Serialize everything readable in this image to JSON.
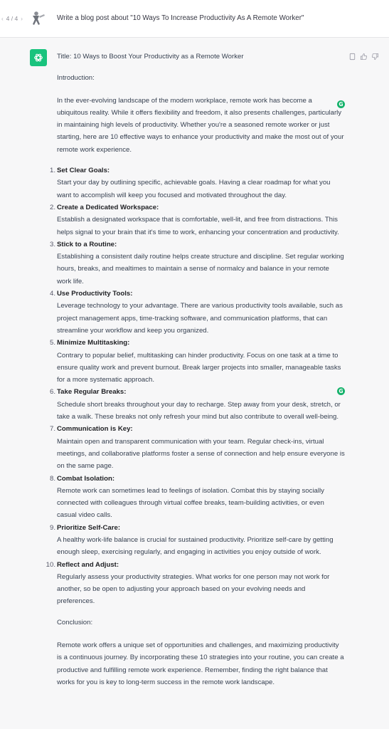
{
  "user": {
    "pager": "4 / 4",
    "prompt": "Write a blog post about \"10 Ways To Increase Productivity As A Remote Worker\""
  },
  "assistant": {
    "title": "Title: 10 Ways to Boost Your Productivity as a Remote Worker",
    "intro_heading": "Introduction:",
    "intro": "In the ever-evolving landscape of the modern workplace, remote work has become a ubiquitous reality. While it offers flexibility and freedom, it also presents challenges, particularly in maintaining high levels of productivity. Whether you're a seasoned remote worker or just starting, here are 10 effective ways to enhance your productivity and make the most out of your remote work experience.",
    "tips": [
      {
        "num": "1.",
        "title": "Set Clear Goals:",
        "body": "Start your day by outlining specific, achievable goals. Having a clear roadmap for what you want to accomplish will keep you focused and motivated throughout the day."
      },
      {
        "num": "2.",
        "title": "Create a Dedicated Workspace:",
        "body": "Establish a designated workspace that is comfortable, well-lit, and free from distractions. This helps signal to your brain that it's time to work, enhancing your concentration and productivity."
      },
      {
        "num": "3.",
        "title": "Stick to a Routine:",
        "body": "Establishing a consistent daily routine helps create structure and discipline. Set regular working hours, breaks, and mealtimes to maintain a sense of normalcy and balance in your remote work life."
      },
      {
        "num": "4.",
        "title": "Use Productivity Tools:",
        "body": "Leverage technology to your advantage. There are various productivity tools available, such as project management apps, time-tracking software, and communication platforms, that can streamline your workflow and keep you organized."
      },
      {
        "num": "5.",
        "title": "Minimize Multitasking:",
        "body": "Contrary to popular belief, multitasking can hinder productivity. Focus on one task at a time to ensure quality work and prevent burnout. Break larger projects into smaller, manageable tasks for a more systematic approach."
      },
      {
        "num": "6.",
        "title": "Take Regular Breaks:",
        "body": "Schedule short breaks throughout your day to recharge. Step away from your desk, stretch, or take a walk. These breaks not only refresh your mind but also contribute to overall well-being."
      },
      {
        "num": "7.",
        "title": "Communication is Key:",
        "body": "Maintain open and transparent communication with your team. Regular check-ins, virtual meetings, and collaborative platforms foster a sense of connection and help ensure everyone is on the same page."
      },
      {
        "num": "8.",
        "title": "Combat Isolation:",
        "body": "Remote work can sometimes lead to feelings of isolation. Combat this by staying socially connected with colleagues through virtual coffee breaks, team-building activities, or even casual video calls."
      },
      {
        "num": "9.",
        "title": "Prioritize Self-Care:",
        "body": "A healthy work-life balance is crucial for sustained productivity. Prioritize self-care by getting enough sleep, exercising regularly, and engaging in activities you enjoy outside of work."
      },
      {
        "num": "10.",
        "title": "Reflect and Adjust:",
        "body": "Regularly assess your productivity strategies. What works for one person may not work for another, so be open to adjusting your approach based on your evolving needs and preferences."
      }
    ],
    "conclusion_heading": "Conclusion:",
    "conclusion": "Remote work offers a unique set of opportunities and challenges, and maximizing productivity is a continuous journey. By incorporating these 10 strategies into your routine, you can create a productive and fulfilling remote work experience. Remember, finding the right balance that works for you is key to long-term success in the remote work landscape."
  },
  "extension_badge": {
    "letter": "G"
  },
  "colors": {
    "brand_green": "#19c37d",
    "badge_green": "#15b26b",
    "assistant_bg": "#f7f7f8"
  },
  "icons": [
    "chevron-left-icon",
    "chevron-right-icon",
    "user-avatar-icon",
    "chatgpt-logo-icon",
    "copy-icon",
    "thumbs-up-icon",
    "thumbs-down-icon",
    "grammarly-badge-icon"
  ]
}
